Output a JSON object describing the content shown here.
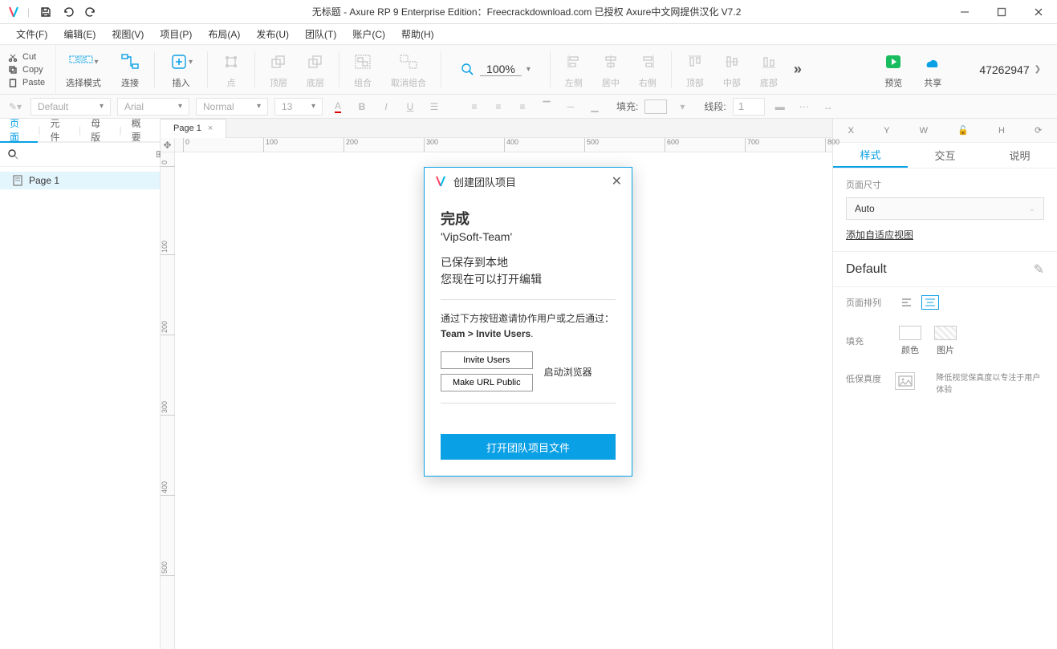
{
  "title": "无标题 - Axure RP 9 Enterprise Edition：Freecrackdownload.com 已授权    Axure中文网提供汉化 V7.2",
  "menu": [
    "文件(F)",
    "编辑(E)",
    "视图(V)",
    "项目(P)",
    "布局(A)",
    "发布(U)",
    "团队(T)",
    "账户(C)",
    "帮助(H)"
  ],
  "clip": {
    "cut": "Cut",
    "copy": "Copy",
    "paste": "Paste"
  },
  "tools": {
    "select": "选择模式",
    "connect": "连接",
    "insert": "插入",
    "point": "点",
    "top": "顶层",
    "bottom": "底层",
    "group": "组合",
    "ungroup": "取消组合",
    "zoom": "100%",
    "alignL": "左侧",
    "alignC": "居中",
    "alignR": "右侧",
    "distT": "顶部",
    "distM": "中部",
    "distB": "底部",
    "preview": "预览",
    "share": "共享"
  },
  "account": "47262947",
  "format": {
    "style": "Default",
    "font": "Arial",
    "weight": "Normal",
    "size": "13",
    "fillLabel": "填充:",
    "lineLabel": "线段:",
    "lineval": "1"
  },
  "leftTabs": [
    "页面",
    "元件",
    "母版",
    "概要"
  ],
  "pageName": "Page 1",
  "tabPage": "Page 1",
  "rulerH": [
    "0",
    "100",
    "200",
    "300",
    "400",
    "500",
    "600",
    "700",
    "800"
  ],
  "rulerV": [
    "0",
    "100",
    "200",
    "300",
    "400",
    "500"
  ],
  "rp": {
    "coords": {
      "x": "X",
      "y": "Y",
      "w": "W",
      "h": "H",
      "lock": "🔒"
    },
    "tabs": [
      "样式",
      "交互",
      "说明"
    ],
    "pageSizeLabel": "页面尺寸",
    "pageSizeVal": "Auto",
    "adaptLink": "添加自适应视图",
    "defaultHeader": "Default",
    "alignLabel": "页面排列",
    "fillLabel": "填充",
    "colorLabel": "颜色",
    "imgLabel": "图片",
    "lofiLabel": "低保真度",
    "lofiDesc": "降低视觉保真度以专注于用户体验"
  },
  "dialog": {
    "title": "创建团队项目",
    "done": "完成",
    "team": "'VipSoft-Team'",
    "saved": "已保存到本地",
    "open": "您现在可以打开编辑",
    "inviteLine": "通过下方按钮邀请协作用户或之后通过：",
    "inviteBold": "Team > Invite Users",
    "btnInvite": "Invite Users",
    "btnPublic": "Make URL Public",
    "launch": "启动浏览器",
    "primary": "打开团队项目文件"
  }
}
